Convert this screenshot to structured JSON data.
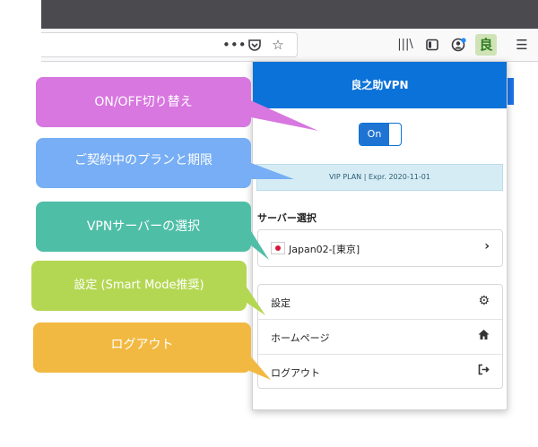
{
  "toolbar": {
    "more_icon": "ellipsis-icon",
    "pocket_icon": "pocket-icon",
    "bookmark_icon": "star-icon",
    "library_icon": "library-icon",
    "sidebar_icon": "sidebar-icon",
    "account_icon": "account-icon",
    "extension_label": "良",
    "menu_icon": "hamburger-menu-icon"
  },
  "popup": {
    "title": "良之助VPN",
    "toggle_label": "On",
    "plan_text": "VIP PLAN | Expr. 2020-11-01",
    "server_section_title": "サーバー選択",
    "server_value": "Japan02-[東京]",
    "menu": [
      {
        "label": "設定",
        "icon": "gear-icon"
      },
      {
        "label": "ホームページ",
        "icon": "home-icon"
      },
      {
        "label": "ログアウト",
        "icon": "logout-icon"
      }
    ]
  },
  "callouts": [
    {
      "text": "ON/OFF切り替え",
      "color": "#d877e0"
    },
    {
      "text": "ご契約中のプランと期限",
      "color": "#77aef5"
    },
    {
      "text": "VPNサーバーの選択",
      "color": "#4fbea7"
    },
    {
      "text": "設定 (Smart Mode推奨)",
      "color": "#b4d753"
    },
    {
      "text": "ログアウト",
      "color": "#f2b942"
    }
  ],
  "colors": {
    "accent": "#0b72d9",
    "plan_bg": "#d6ecf5"
  }
}
